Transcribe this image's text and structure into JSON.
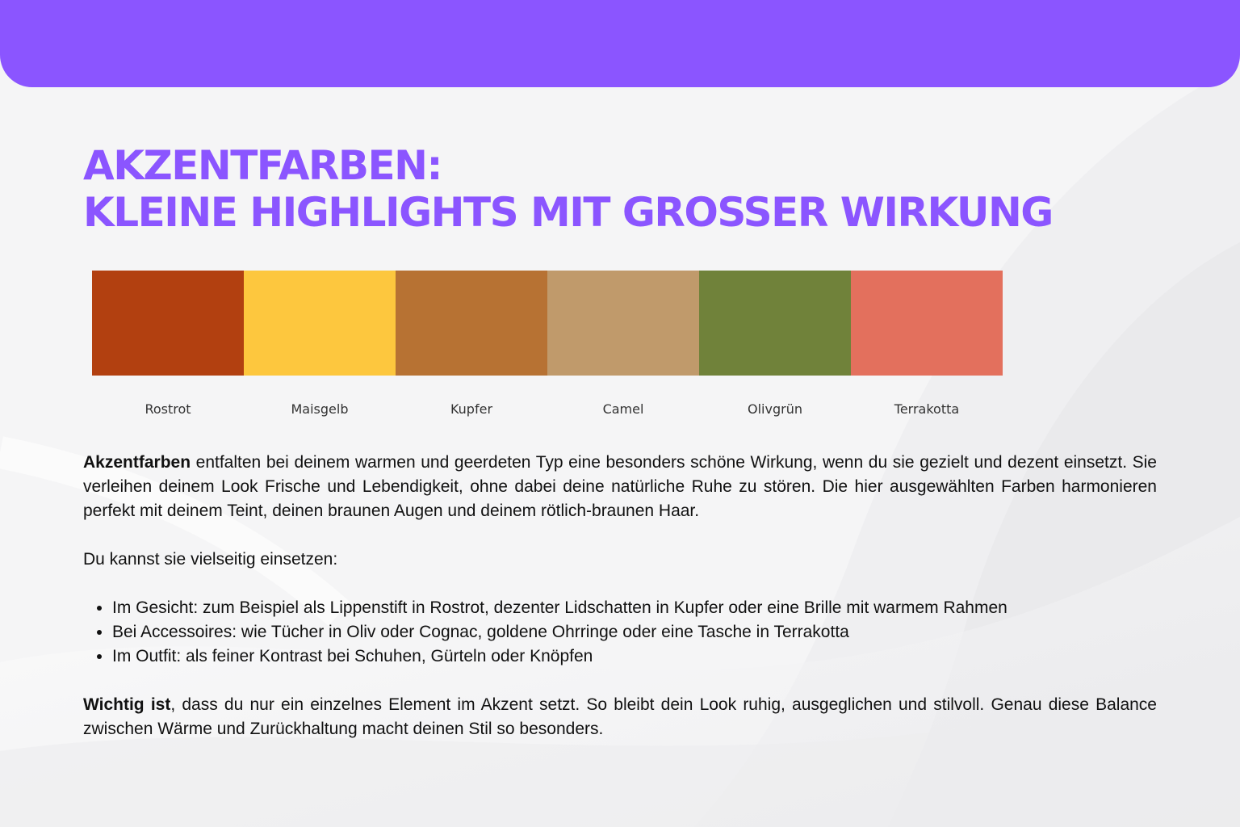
{
  "title": {
    "line1": "AKZENTFARBEN:",
    "line2": "KLEINE HIGHLIGHTS MIT GROSSER WIRKUNG"
  },
  "colors": {
    "header": "#8B55FF",
    "title": "#8B55FF"
  },
  "palette": [
    {
      "label": "Rostrot",
      "color": "#B24010"
    },
    {
      "label": "Maisgelb",
      "color": "#FDC73E"
    },
    {
      "label": "Kupfer",
      "color": "#B77233"
    },
    {
      "label": "Camel",
      "color": "#C09A6B"
    },
    {
      "label": "Olivgrün",
      "color": "#70823A"
    },
    {
      "label": "Terrakotta",
      "color": "#E3705D"
    }
  ],
  "intro": {
    "bold": "Akzentfarben",
    "text": " entfalten bei deinem warmen und geerdeten Typ eine besonders schöne Wirkung, wenn du sie gezielt und dezent einsetzt. Sie verleihen deinem Look Frische und Lebendigkeit, ohne dabei deine natürliche Ruhe zu stören. Die hier ausgewählten Farben harmonieren perfekt mit deinem Teint, deinen braunen Augen und deinem rötlich-braunen Haar."
  },
  "usage_intro": "Du kannst sie vielseitig einsetzen:",
  "usage_items": [
    "Im Gesicht: zum Beispiel als Lippenstift in Rostrot, dezenter Lidschatten in Kupfer oder eine Brille mit warmem Rahmen",
    "Bei Accessoires: wie Tücher in Oliv oder Cognac, goldene Ohrringe oder eine Tasche in Terrakotta",
    "Im Outfit: als feiner Kontrast bei Schuhen, Gürteln oder Knöpfen"
  ],
  "closing": {
    "bold": "Wichtig ist",
    "text": ", dass du nur ein einzelnes Element im Akzent setzt. So bleibt dein Look ruhig, ausgeglichen und stilvoll. Genau diese Balance zwischen Wärme und Zurückhaltung macht deinen Stil so besonders."
  }
}
